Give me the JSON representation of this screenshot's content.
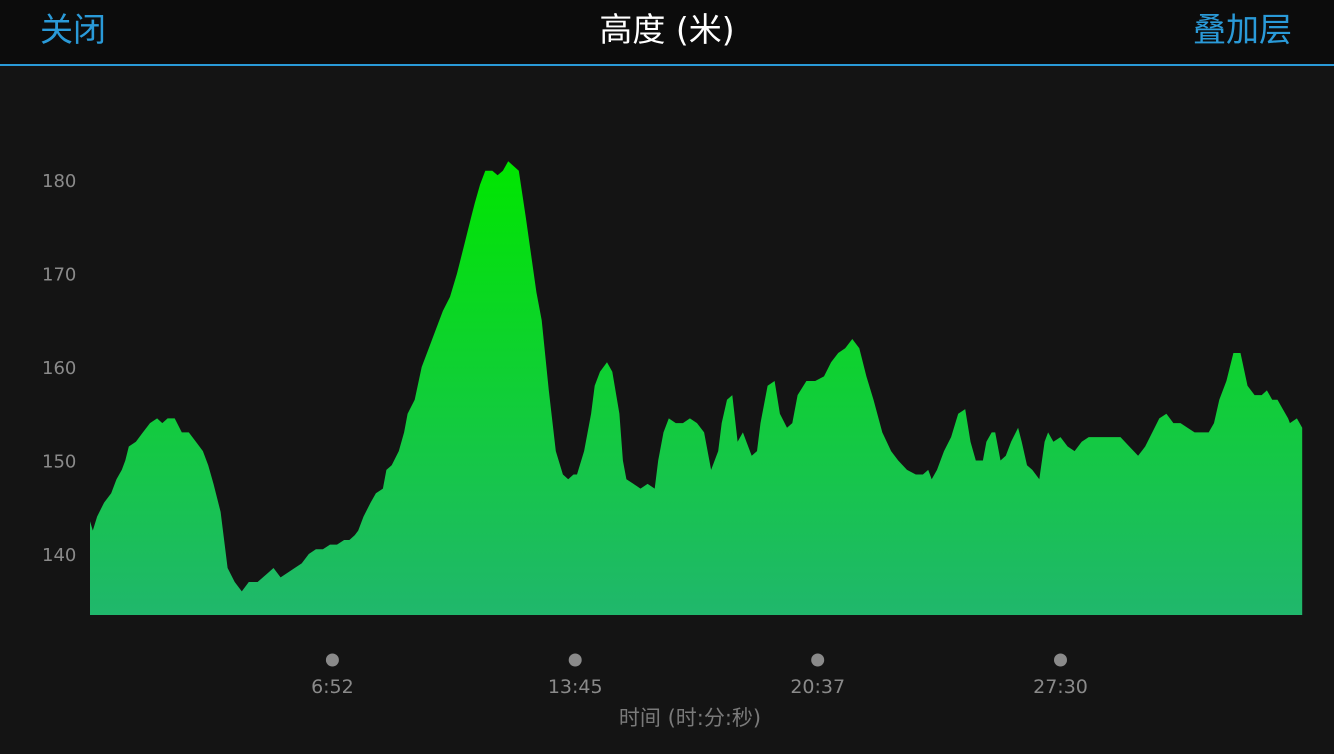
{
  "header": {
    "close_label": "关闭",
    "title": "高度 (米)",
    "layers_label": "叠加层"
  },
  "colors": {
    "accent": "#2a9ad8",
    "background": "#141414",
    "fill_top": "#00e600",
    "fill_bottom": "#20b76c"
  },
  "chart_data": {
    "type": "area",
    "title": "高度 (米)",
    "xlabel": "时间 (时:分:秒)",
    "ylabel": "",
    "y_ticks": [
      140,
      150,
      160,
      170,
      180
    ],
    "x_ticks": [
      {
        "label": "6:52",
        "t": 6.87
      },
      {
        "label": "13:45",
        "t": 13.75
      },
      {
        "label": "20:37",
        "t": 20.62
      },
      {
        "label": "27:30",
        "t": 27.5
      }
    ],
    "xlim": [
      0,
      34.4
    ],
    "ylim": [
      133.5,
      190
    ],
    "grid": false,
    "series": [
      {
        "x": [
          0,
          0.08,
          0.2,
          0.4,
          0.6,
          0.75,
          0.9,
          1.0,
          1.1,
          1.3,
          1.5,
          1.7,
          1.9,
          2.05,
          2.2,
          2.4,
          2.6,
          2.8,
          3.0,
          3.2,
          3.35,
          3.5,
          3.7,
          3.9,
          4.1,
          4.3,
          4.5,
          4.55,
          4.65,
          4.75,
          4.9,
          5.05,
          5.2,
          5.4,
          5.6,
          5.8,
          6.0,
          6.2,
          6.4,
          6.6,
          6.8,
          7.0,
          7.2,
          7.35,
          7.5,
          7.6,
          7.75,
          7.95,
          8.1,
          8.3,
          8.4,
          8.55,
          8.75,
          8.9,
          9.0,
          9.2,
          9.4,
          9.6,
          9.8,
          10.0,
          10.2,
          10.4,
          10.6,
          10.8,
          10.9,
          11.05,
          11.2,
          11.4,
          11.55,
          11.7,
          11.85,
          12.0,
          12.15,
          12.35,
          12.5,
          12.65,
          12.8,
          13.0,
          13.2,
          13.4,
          13.55,
          13.7,
          13.8,
          14.0,
          14.2,
          14.3,
          14.45,
          14.55,
          14.65,
          14.8,
          15.0,
          15.1,
          15.2,
          15.4,
          15.6,
          15.8,
          16.0,
          16.1,
          16.25,
          16.4,
          16.6,
          16.8,
          17.0,
          17.2,
          17.4,
          17.6,
          17.8,
          17.9,
          18.05,
          18.2,
          18.35,
          18.5,
          18.6,
          18.75,
          18.9,
          19.0,
          19.2,
          19.4,
          19.55,
          19.75,
          19.9,
          20.05,
          20.3,
          20.55,
          20.8,
          21.0,
          21.2,
          21.4,
          21.6,
          21.8,
          22.0,
          22.2,
          22.45,
          22.7,
          22.9,
          23.15,
          23.4,
          23.6,
          23.75,
          23.85,
          24.0,
          24.2,
          24.4,
          24.6,
          24.8,
          24.95,
          25.1,
          25.3,
          25.4,
          25.55,
          25.65,
          25.8,
          25.95,
          26.1,
          26.3,
          26.4,
          26.55,
          26.7,
          26.9,
          27.05,
          27.15,
          27.3,
          27.5,
          27.7,
          27.9,
          28.1,
          28.3,
          28.5,
          28.7,
          28.95,
          29.2,
          29.45,
          29.7,
          29.9,
          30.1,
          30.3,
          30.5,
          30.7,
          30.9,
          31.1,
          31.3,
          31.5,
          31.7,
          31.85,
          32.0,
          32.2,
          32.4,
          32.6,
          32.8,
          33.0,
          33.2,
          33.35,
          33.5,
          33.65,
          33.8,
          33.95,
          34.0,
          34.2,
          34.35
        ],
        "values": [
          143.5,
          142.5,
          144,
          145.5,
          146.5,
          148,
          149,
          150,
          151.5,
          152,
          153,
          154,
          154.5,
          154,
          154.5,
          154.5,
          153,
          153,
          152,
          151,
          149.5,
          147.5,
          144.5,
          138.5,
          137,
          136,
          137,
          137,
          137,
          137,
          137.5,
          138,
          138.5,
          137.5,
          138,
          138.5,
          139,
          140,
          140.5,
          140.5,
          141,
          141,
          141.5,
          141.5,
          142,
          142.5,
          144,
          145.5,
          146.5,
          147,
          149,
          149.5,
          151,
          153,
          155,
          156.5,
          160,
          162,
          164,
          166,
          167.5,
          170,
          173,
          176,
          177.5,
          179.5,
          181,
          181,
          180.5,
          181,
          182,
          181.5,
          181,
          176,
          172,
          168,
          165,
          157.5,
          151,
          148.5,
          148,
          148.5,
          148.5,
          151,
          155,
          158,
          159.5,
          160,
          160.5,
          159.5,
          155,
          150,
          148,
          147.5,
          147,
          147.5,
          147,
          150,
          153,
          154.5,
          154,
          154,
          154.5,
          154,
          153,
          149,
          151,
          154,
          156.5,
          157,
          152,
          153,
          152,
          150.5,
          151,
          154,
          158,
          158.5,
          155,
          153.5,
          154,
          157,
          158.5,
          158.5,
          159,
          160.5,
          161.5,
          162,
          163,
          162,
          159,
          156.5,
          153,
          151,
          150,
          149,
          148.5,
          148.5,
          149,
          148,
          149,
          151,
          152.5,
          155,
          155.5,
          152,
          150,
          150,
          152,
          153,
          153,
          150,
          150.5,
          152,
          153.5,
          152,
          149.5,
          149,
          148,
          152,
          153,
          152,
          152.5,
          151.5,
          151,
          152,
          152.5,
          152.5,
          152.5,
          152.5,
          152.5,
          151.5,
          150.5,
          151.5,
          153,
          154.5,
          155,
          154,
          154,
          153.5,
          153,
          153,
          153,
          154,
          156.5,
          158.5,
          161.5,
          161.5,
          158,
          157,
          157,
          157.5,
          156.5,
          156.5,
          155.5,
          154.5,
          154,
          154.5,
          153.5
        ]
      }
    ]
  }
}
